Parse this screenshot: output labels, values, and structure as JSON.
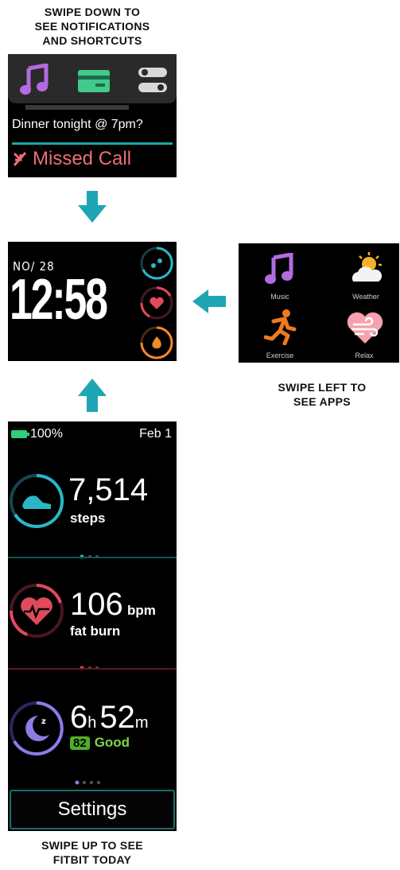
{
  "captions": {
    "top": [
      "SWIPE DOWN TO",
      "SEE NOTIFICATIONS",
      "AND SHORTCUTS"
    ],
    "apps": [
      "SWIPE LEFT TO",
      "SEE APPS"
    ],
    "bottom": [
      "SWIPE UP TO SEE",
      "FITBIT TODAY"
    ]
  },
  "notifications": {
    "icons": [
      "music-note-icon",
      "wallet-card-icon",
      "toggle-settings-icon"
    ],
    "message": "Dinner tonight @ 7pm?",
    "missed_call": "Missed Call",
    "colors": {
      "music": "#b36be0",
      "wallet": "#43c98a",
      "divider": "#1fa6a6",
      "missed": "#ee6e72"
    }
  },
  "clock": {
    "date": "NO/ 28",
    "time": "12:58",
    "rings": [
      "steps-ring-icon",
      "heart-ring-icon",
      "calories-ring-icon"
    ]
  },
  "apps": {
    "items": [
      {
        "label": "Music",
        "icon": "music-note-icon"
      },
      {
        "label": "Weather",
        "icon": "weather-sun-cloud-icon"
      },
      {
        "label": "Exercise",
        "icon": "runner-icon"
      },
      {
        "label": "Relax",
        "icon": "breathing-heart-icon"
      }
    ]
  },
  "today": {
    "status": {
      "battery": "100%",
      "date": "Feb 1"
    },
    "steps": {
      "value": "7,514",
      "label": "steps"
    },
    "heart": {
      "value": "106",
      "unit": "bpm",
      "label": "fat burn"
    },
    "sleep": {
      "hours": "6",
      "h_unit": "h",
      "minutes": "52",
      "m_unit": "m",
      "score": "82",
      "quality": "Good"
    },
    "settings_label": "Settings"
  }
}
